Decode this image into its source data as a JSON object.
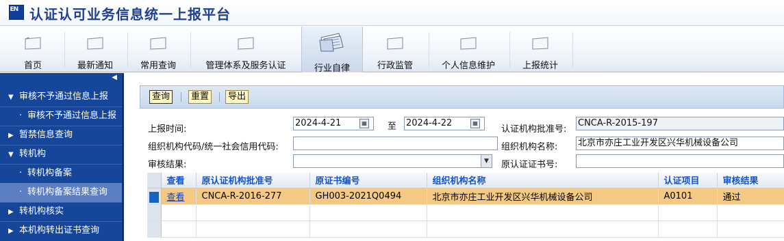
{
  "app": {
    "logo_text": "EN",
    "title": "认证认可业务信息统一上报平台"
  },
  "nav": [
    {
      "label": "首页",
      "icon": "folder-icon"
    },
    {
      "label": "最新通知",
      "icon": "folder-icon"
    },
    {
      "label": "常用查询",
      "icon": "folder-icon"
    },
    {
      "label": "管理体系及服务认证",
      "icon": "folder-icon"
    },
    {
      "label": "行业自律",
      "icon": "open-folder-documents-icon",
      "active": true
    },
    {
      "label": "行政监管",
      "icon": "folder-icon"
    },
    {
      "label": "个人信息维护",
      "icon": "folder-icon"
    },
    {
      "label": "上报统计",
      "icon": "folder-icon"
    }
  ],
  "sidebar": {
    "collapse_icon": "triangle-left-icon",
    "items": [
      {
        "label": "审核不予通过信息上报",
        "arrow": "▼",
        "type": "group"
      },
      {
        "label": "审核不予通过信息上报",
        "bullet": "·",
        "type": "sub"
      },
      {
        "label": "暂禁信息查询",
        "arrow": "▶",
        "type": "group"
      },
      {
        "label": "转机构",
        "arrow": "▼",
        "type": "group"
      },
      {
        "label": "转机构备案",
        "bullet": "·",
        "type": "sub"
      },
      {
        "label": "转机构备案结果查询",
        "bullet": "·",
        "type": "sub",
        "selected": true
      },
      {
        "label": "转机构核实",
        "arrow": "▶",
        "type": "group"
      },
      {
        "label": "本机构转出证书查询",
        "arrow": "▶",
        "type": "group"
      }
    ]
  },
  "toolbar": {
    "query_label": "查询",
    "reset_label": "重置",
    "export_label": "导出"
  },
  "form": {
    "report_time_label": "上报时间:",
    "date_from": "2024-4-21",
    "to_label": "至",
    "date_to": "2024-4-22",
    "approval_no_label": "认证机构批准号:",
    "approval_no_value": "CNCA-R-2015-197",
    "org_code_label": "组织机构代码/统一社会信用代码:",
    "org_code_value": "",
    "org_name_label": "组织机构名称:",
    "org_name_value": "北京市亦庄工业开发区兴华机械设备公司",
    "audit_result_label": "审核结果:",
    "audit_result_value": "",
    "orig_cert_no_label": "原认证证书号:",
    "orig_cert_no_value": ""
  },
  "table": {
    "headers": [
      "查看",
      "原认证机构批准号",
      "原证书编号",
      "组织机构名称",
      "认证项目",
      "审核结果"
    ],
    "rows": [
      [
        "查看",
        "CNCA-R-2016-277",
        "GH003-2021Q0494",
        "北京市亦庄工业开发区兴华机械设备公司",
        "A0101",
        "通过"
      ]
    ]
  },
  "colors": {
    "sidebar_bg": "#16469a",
    "selected_row": "#f4c984",
    "header_text": "#1155cc",
    "title_text": "#1f3f8f"
  }
}
